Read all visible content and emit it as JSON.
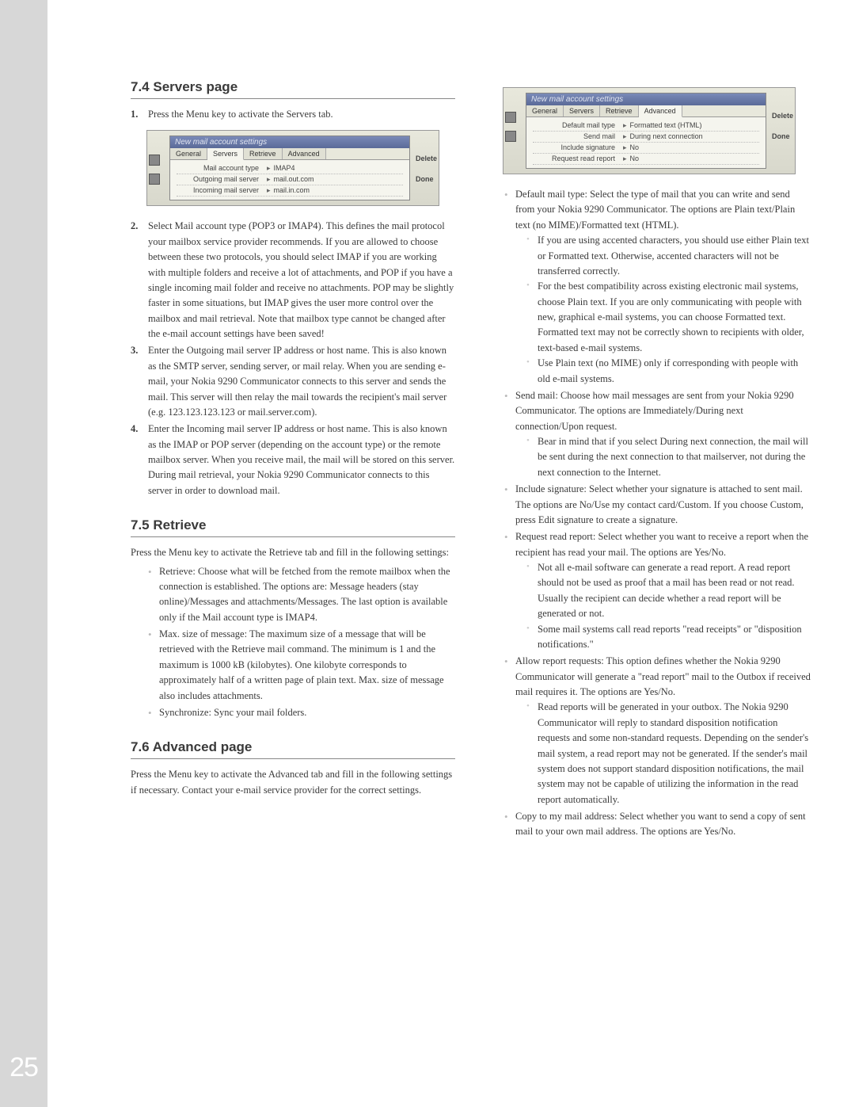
{
  "page_number": "25",
  "section_74": {
    "heading": "7.4 Servers page",
    "item1_num": "1.",
    "item1": "Press the Menu key to activate the Servers tab.",
    "item2_num": "2.",
    "item2": "Select Mail account type (POP3 or IMAP4). This defines the mail protocol your mailbox service provider recommends. If you are allowed to choose between these two protocols, you should select IMAP if you are working with multiple folders and receive a lot of attachments, and POP if you have a single incoming mail folder and receive no attachments. POP may be slightly faster in some situations, but IMAP gives the user more control over the mailbox and mail retrieval. Note that mailbox type cannot be changed after the e-mail account settings have been saved!",
    "item3_num": "3.",
    "item3": "Enter the Outgoing mail server IP address or host name. This is also known as the SMTP server, sending server, or mail relay. When you are sending e-mail, your Nokia 9290 Communicator connects to this server and sends the mail. This server will then relay the mail towards the recipient's mail server (e.g. 123.123.123.123 or mail.server.com).",
    "item4_num": "4.",
    "item4": "Enter the Incoming mail server IP address or host name. This is also known as the IMAP or POP server (depending on the account type) or the remote mailbox server. When you receive mail, the mail will be stored on this server. During mail retrieval, your Nokia 9290 Communicator connects to this server in order to download mail."
  },
  "section_75": {
    "heading": "7.5 Retrieve",
    "intro": "Press the Menu key to activate the Retrieve tab and fill in the following settings:",
    "b1": "Retrieve: Choose what will be fetched from the remote mailbox when the connection is established. The options are: Message headers (stay online)/Messages and attachments/Messages. The last option is available only if the Mail account type is IMAP4.",
    "b2": "Max. size of message: The maximum size of a message that will be retrieved with the Retrieve mail command. The minimum is 1 and the maximum is 1000 kB (kilobytes). One kilobyte corresponds to approximately half of a written page of plain text. Max. size of message also includes attachments.",
    "b3": "Synchronize: Sync your mail folders."
  },
  "section_76": {
    "heading": "7.6 Advanced page",
    "intro": "Press the Menu key to activate the Advanced tab and fill in the following settings if necessary. Contact your e-mail service provider for the correct settings.",
    "b1": "Default mail type: Select the type of mail that you can write and send from your Nokia 9290 Communicator. The options are Plain text/Plain text (no MIME)/Formatted text (HTML).",
    "b1s1": "If you are using accented characters, you should use either Plain text or Formatted text. Otherwise, accented characters will not be transferred correctly.",
    "b1s2": "For the best compatibility across existing electronic mail systems, choose Plain text. If you are only communicating with people with new, graphical e-mail systems, you can choose Formatted text. Formatted text may not be correctly shown to recipients with older, text-based e-mail systems.",
    "b1s3": "Use Plain text (no MIME) only if corresponding with people with old e-mail systems.",
    "b2": "Send mail: Choose how mail messages are sent from your Nokia 9290 Communicator. The options are Immediately/During next connection/Upon request.",
    "b2s1": "Bear in mind that if you select During next connection, the mail will be sent during the next connection to that mailserver, not during the next connection to the Internet.",
    "b3": "Include signature: Select whether your signature is attached to sent mail. The options are No/Use my contact card/Custom. If you choose Custom, press Edit signature to create a signature.",
    "b4": "Request read report: Select whether you want to receive a report when the recipient has read your mail. The options are Yes/No.",
    "b4s1": "Not all e-mail software can generate a read report. A read report should not be used as proof that a mail has been read or not read. Usually the recipient can decide whether a read report will be generated or not.",
    "b4s2": "Some mail systems call read reports \"read receipts\" or \"disposition notifications.\"",
    "b5": "Allow report requests: This option defines whether the Nokia 9290 Communicator will generate a \"read report\" mail to the Outbox if received mail requires it. The options are Yes/No.",
    "b5s1": "Read reports will be generated in your outbox. The Nokia 9290 Communicator will reply to standard disposition notification requests and some non-standard requests. Depending on the sender's mail system, a read report may not be generated. If the sender's mail system does not support standard disposition notifications, the mail system may not be capable of utilizing the information in the read report automatically.",
    "b6": "Copy to my mail address: Select whether you want to send a copy of sent mail to your own mail address. The options are Yes/No."
  },
  "shot1": {
    "title": "New mail account settings",
    "tabs": [
      "General",
      "Servers",
      "Retrieve",
      "Advanced"
    ],
    "active": 1,
    "row1_lbl": "Mail account type",
    "row1_val": "IMAP4",
    "row2_lbl": "Outgoing mail server",
    "row2_val": "mail.out.com",
    "row3_lbl": "Incoming mail server",
    "row3_val": "mail.in.com",
    "btn1": "Delete",
    "btn2": "Done"
  },
  "shot2": {
    "title": "New mail account settings",
    "tabs": [
      "General",
      "Servers",
      "Retrieve",
      "Advanced"
    ],
    "active": 3,
    "row1_lbl": "Default mail type",
    "row1_val": "Formatted text (HTML)",
    "row2_lbl": "Send mail",
    "row2_val": "During next connection",
    "row3_lbl": "Include signature",
    "row3_val": "No",
    "row4_lbl": "Request read report",
    "row4_val": "No",
    "btn1": "Delete",
    "btn2": "Done"
  }
}
